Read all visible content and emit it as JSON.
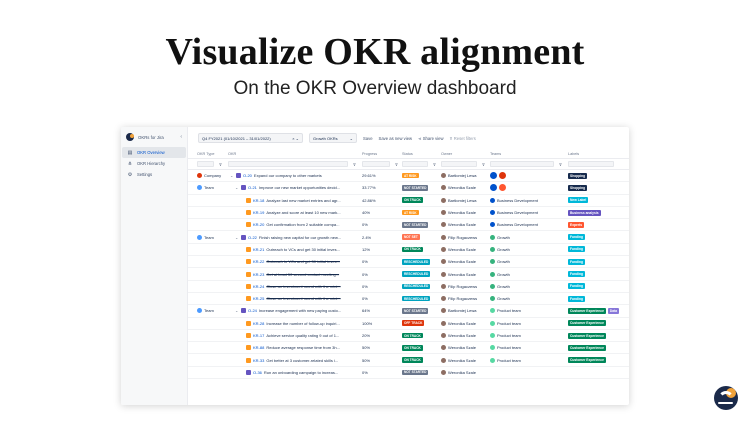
{
  "hero": {
    "title": "Visualize OKR alignment",
    "subtitle": "On the OKR Overview dashboard"
  },
  "sidebar": {
    "app_name": "OKRs for Jira",
    "collapse_icon": "chevron-left-icon",
    "items": [
      {
        "label": "OKR Overview",
        "icon": "table-icon",
        "active": true
      },
      {
        "label": "OKR Hierarchy",
        "icon": "hierarchy-icon",
        "active": false
      },
      {
        "label": "Settings",
        "icon": "gear-icon",
        "active": false
      }
    ]
  },
  "toolbar": {
    "period_value": "Q4 FY2021 (01/10/2021 – 31/01/2022)",
    "group_value": "Growth OKRs",
    "save_label": "Save",
    "save_as_label": "Save as new view",
    "share_label": "Share view",
    "reset_label": "Reset filters"
  },
  "columns": {
    "type": "OKR Type",
    "okr": "OKR",
    "progress": "Progress",
    "status": "Status",
    "owner": "Owner",
    "teams": "Teams",
    "labels": "Labels"
  },
  "colors": {
    "company": "#de350b",
    "team": "#4c9aff",
    "objective": "#6554c0",
    "key_result": "#ff991f",
    "at_risk": "#ff991f",
    "not_started": "#6b778c",
    "on_track": "#00875a",
    "rescheduled": "#00a3bf",
    "off_track": "#de350b",
    "not_set": "#ff7452",
    "business": "#0052cc",
    "growth": "#36b37e",
    "product": "#57d9a3"
  },
  "rows": [
    {
      "type": "Company",
      "indent": 0,
      "chev": "v",
      "key": "O-20",
      "title": "Expand our company to other markets",
      "strike": false,
      "progress": "29.61%",
      "status": "AT RISK",
      "status_color": "#ff991f",
      "owner": "Bartłomiej Lewa",
      "teams": "",
      "team_icons": "avatars",
      "labels": [
        {
          "text": "Shopping",
          "color": "#172b4d"
        }
      ]
    },
    {
      "type": "Team",
      "indent": 1,
      "chev": "v",
      "key": "O-21",
      "title": "Improve our new market opportunities decid...",
      "strike": false,
      "progress": "33.77%",
      "status": "NOT STARTED",
      "status_color": "#6b778c",
      "owner": "Weronika Szale",
      "teams": "",
      "team_icons": "avatars2",
      "labels": [
        {
          "text": "Shopping",
          "color": "#172b4d"
        }
      ]
    },
    {
      "type": "",
      "indent": 2,
      "chev": "",
      "key": "KR-18",
      "title": "Analyze last new market entries and agr...",
      "strike": false,
      "progress": "42.86%",
      "status": "ON TRACK",
      "status_color": "#00875a",
      "owner": "Bartłomiej Lewa",
      "teams": "Business Development",
      "team_icons": "business",
      "labels": [
        {
          "text": "New Label",
          "color": "#00b8d9"
        }
      ]
    },
    {
      "type": "",
      "indent": 2,
      "chev": "",
      "key": "KR-19",
      "title": "Analyze and score at least 10 new mark...",
      "strike": false,
      "progress": "40%",
      "status": "AT RISK",
      "status_color": "#ff991f",
      "owner": "Weronika Szale",
      "teams": "Business Development",
      "team_icons": "business",
      "labels": [
        {
          "text": "Business analysis",
          "color": "#6554c0"
        }
      ]
    },
    {
      "type": "",
      "indent": 2,
      "chev": "",
      "key": "KR-20",
      "title": "Get confirmation from 2 suitable compa...",
      "strike": false,
      "progress": "0%",
      "status": "NOT STARTED",
      "status_color": "#6b778c",
      "owner": "Weronika Szale",
      "teams": "Business Development",
      "team_icons": "business",
      "labels": [
        {
          "text": "Experts",
          "color": "#ff5630"
        }
      ]
    },
    {
      "type": "Team",
      "indent": 1,
      "chev": "v",
      "key": "O-22",
      "title": "Finish raising new capital for our growth new...",
      "strike": false,
      "progress": "2.4%",
      "status": "NOT SET",
      "status_color": "#ff7452",
      "owner": "Filip Rogaczews",
      "teams": "Growth",
      "team_icons": "growth",
      "labels": [
        {
          "text": "Funding",
          "color": "#00b8d9"
        }
      ]
    },
    {
      "type": "",
      "indent": 2,
      "chev": "",
      "key": "KR-21",
      "title": "Outreach to VCs and get 30 initial inves...",
      "strike": false,
      "progress": "12%",
      "status": "ON TRACK",
      "status_color": "#00875a",
      "owner": "Weronika Szale",
      "teams": "Growth",
      "team_icons": "growth",
      "labels": [
        {
          "text": "Funding",
          "color": "#00b8d9"
        }
      ]
    },
    {
      "type": "",
      "indent": 2,
      "chev": "",
      "key": "KR-22",
      "title": "Outreach to VCs and get 30 initial inves...",
      "strike": true,
      "progress": "0%",
      "status": "RESCHEDULED",
      "status_color": "#00a3bf",
      "owner": "Weronika Szale",
      "teams": "Growth",
      "team_icons": "growth",
      "labels": [
        {
          "text": "Funding",
          "color": "#00b8d9"
        }
      ]
    },
    {
      "type": "",
      "indent": 2,
      "chev": "",
      "key": "KR-23",
      "title": "Get at least 50 second contact meeting...",
      "strike": true,
      "progress": "0%",
      "status": "RESCHEDULED",
      "status_color": "#00a3bf",
      "owner": "Weronika Szale",
      "teams": "Growth",
      "team_icons": "growth",
      "labels": [
        {
          "text": "Funding",
          "color": "#00b8d9"
        }
      ]
    },
    {
      "type": "",
      "indent": 2,
      "chev": "",
      "key": "KR-24",
      "title": "Close an investment round with the mini...",
      "strike": true,
      "progress": "0%",
      "status": "RESCHEDULED",
      "status_color": "#00a3bf",
      "owner": "Filip Rogaczews",
      "teams": "Growth",
      "team_icons": "growth",
      "labels": [
        {
          "text": "Funding",
          "color": "#00b8d9"
        }
      ]
    },
    {
      "type": "",
      "indent": 2,
      "chev": "",
      "key": "KR-25",
      "title": "Close an investment round with the mini...",
      "strike": true,
      "progress": "0%",
      "status": "RESCHEDULED",
      "status_color": "#00a3bf",
      "owner": "Filip Rogaczews",
      "teams": "Growth",
      "team_icons": "growth",
      "labels": [
        {
          "text": "Funding",
          "color": "#00b8d9"
        }
      ]
    },
    {
      "type": "Team",
      "indent": 1,
      "chev": "v",
      "key": "O-24",
      "title": "Increase engagement with new paying custo...",
      "strike": false,
      "progress": "64%",
      "status": "NOT STARTED",
      "status_color": "#6b778c",
      "owner": "Bartłomiej Lewa",
      "teams": "Product team",
      "team_icons": "product",
      "labels": [
        {
          "text": "Customer Experience",
          "color": "#00875a"
        },
        {
          "text": "Data",
          "color": "#8777d9"
        }
      ]
    },
    {
      "type": "",
      "indent": 2,
      "chev": "",
      "key": "KR-28",
      "title": "Increase the number of follow-up inquiri...",
      "strike": false,
      "progress": "100%",
      "status": "OFF TRACK",
      "status_color": "#de350b",
      "owner": "Weronika Szale",
      "teams": "Product team",
      "team_icons": "product",
      "labels": [
        {
          "text": "Customer Experience",
          "color": "#00875a"
        }
      ]
    },
    {
      "type": "",
      "indent": 2,
      "chev": "",
      "key": "KR-17",
      "title": "Achieve service quality rating 9 out of 1...",
      "strike": false,
      "progress": "20%",
      "status": "ON TRACK",
      "status_color": "#00875a",
      "owner": "Weronika Szale",
      "teams": "Product team",
      "team_icons": "product",
      "labels": [
        {
          "text": "Customer Experience",
          "color": "#00875a"
        }
      ]
    },
    {
      "type": "",
      "indent": 2,
      "chev": "",
      "key": "KR-88",
      "title": "Reduce average response time from 3h...",
      "strike": false,
      "progress": "50%",
      "status": "ON TRACK",
      "status_color": "#00875a",
      "owner": "Weronika Szale",
      "teams": "Product team",
      "team_icons": "product",
      "labels": [
        {
          "text": "Customer Experience",
          "color": "#00875a"
        }
      ]
    },
    {
      "type": "",
      "indent": 2,
      "chev": "",
      "key": "KR-33",
      "title": "Get better at 3 customer-related skills i...",
      "strike": false,
      "progress": "50%",
      "status": "ON TRACK",
      "status_color": "#00875a",
      "owner": "Weronika Szale",
      "teams": "Product team",
      "team_icons": "product",
      "labels": [
        {
          "text": "Customer Experience",
          "color": "#00875a"
        }
      ]
    },
    {
      "type": "",
      "indent": 2,
      "chev": "",
      "key": "O-36",
      "title": "Run an onboarding campaign to increas...",
      "strike": false,
      "progress": "0%",
      "status": "NOT STARTED",
      "status_color": "#6b778c",
      "owner": "Weronika Szale",
      "teams": "",
      "team_icons": "",
      "labels": []
    }
  ]
}
